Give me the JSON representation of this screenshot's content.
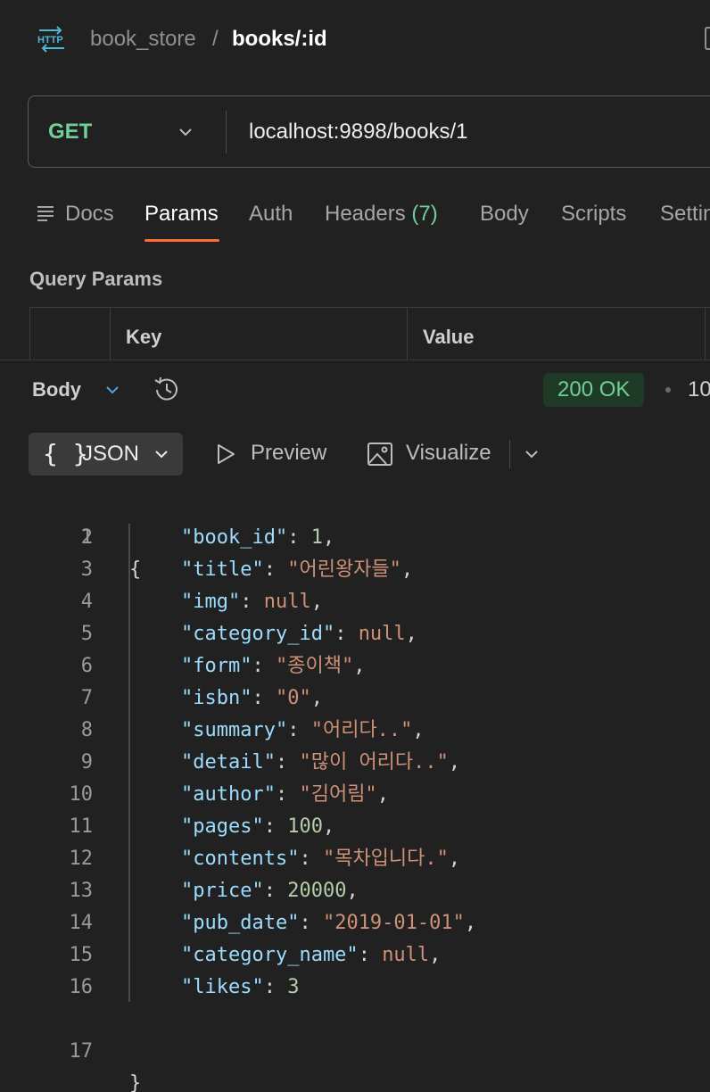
{
  "breadcrumb": {
    "icon": "http-icon",
    "collection": "book_store",
    "separator": "/",
    "request": "books/:id"
  },
  "request": {
    "method": "GET",
    "url": "localhost:9898/books/1"
  },
  "tabs": [
    {
      "label": "Docs"
    },
    {
      "label": "Params"
    },
    {
      "label": "Auth"
    },
    {
      "label": "Headers",
      "count": "(7)"
    },
    {
      "label": "Body"
    },
    {
      "label": "Scripts"
    },
    {
      "label": "Settin"
    }
  ],
  "active_tab": "Params",
  "query_params": {
    "title": "Query Params",
    "columns": [
      "Key",
      "Value"
    ]
  },
  "response": {
    "body_label": "Body",
    "status": "200 OK",
    "time_partial": "10",
    "views": {
      "json": "JSON",
      "preview": "Preview",
      "visualize": "Visualize"
    },
    "line_numbers": [
      "1",
      "2",
      "3",
      "4",
      "5",
      "6",
      "7",
      "8",
      "9",
      "10",
      "11",
      "12",
      "13",
      "14",
      "15",
      "16",
      "17"
    ],
    "open_brace": "{",
    "close_brace": "}",
    "fields": [
      {
        "key": "\"book_id\"",
        "value": "1",
        "type": "number",
        "sep": ","
      },
      {
        "key": "\"title\"",
        "value": "\"어린왕자들\"",
        "type": "string",
        "sep": ","
      },
      {
        "key": "\"img\"",
        "value": "null",
        "type": "null",
        "sep": ","
      },
      {
        "key": "\"category_id\"",
        "value": "null",
        "type": "null",
        "sep": ","
      },
      {
        "key": "\"form\"",
        "value": "\"종이책\"",
        "type": "string",
        "sep": ","
      },
      {
        "key": "\"isbn\"",
        "value": "\"0\"",
        "type": "string",
        "sep": ","
      },
      {
        "key": "\"summary\"",
        "value": "\"어리다..\"",
        "type": "string",
        "sep": ","
      },
      {
        "key": "\"detail\"",
        "value": "\"많이 어리다..\"",
        "type": "string",
        "sep": ","
      },
      {
        "key": "\"author\"",
        "value": "\"김어림\"",
        "type": "string",
        "sep": ","
      },
      {
        "key": "\"pages\"",
        "value": "100",
        "type": "number",
        "sep": ","
      },
      {
        "key": "\"contents\"",
        "value": "\"목차입니다.\"",
        "type": "string",
        "sep": ","
      },
      {
        "key": "\"price\"",
        "value": "20000",
        "type": "number",
        "sep": ","
      },
      {
        "key": "\"pub_date\"",
        "value": "\"2019-01-01\"",
        "type": "string",
        "sep": ","
      },
      {
        "key": "\"category_name\"",
        "value": "null",
        "type": "null",
        "sep": ","
      },
      {
        "key": "\"likes\"",
        "value": "3",
        "type": "number",
        "sep": ""
      }
    ]
  },
  "colors": {
    "background": "#212121",
    "method_get": "#6fcf97",
    "active_tab_underline": "#ff6c37",
    "status_ok_bg": "#1f3b27",
    "json_key": "#9cdcfe",
    "json_string": "#ce9178",
    "json_number": "#b5cea8"
  }
}
